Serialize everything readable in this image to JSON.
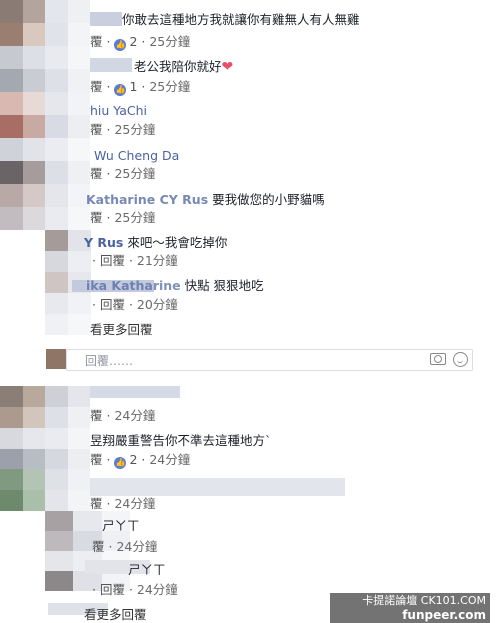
{
  "comments": [
    {
      "text": "你敢去這種地方我就讓你有雞無人有人無雞",
      "reply": "覆",
      "likes": "2",
      "time": "25分鐘"
    },
    {
      "text": "老公我陪你就好",
      "reply": "覆",
      "likes": "1",
      "time": "25分鐘"
    },
    {
      "text": "hiu YaChi",
      "reply": "覆",
      "time": "25分鐘"
    },
    {
      "text": "Wu Cheng Da",
      "reply": "覆",
      "time": "25分鐘"
    },
    {
      "name": "Katharine CY Rus",
      "text": "要我做您的小野貓嗎",
      "reply": "覆",
      "time": "25分鐘"
    }
  ],
  "replies": [
    {
      "name": "Y Rus",
      "text": "來吧～我會吃掉你",
      "reply": "回覆",
      "time": "21分鐘"
    },
    {
      "name": "ika Katharine",
      "text": "快點 狠狠地吃",
      "reply": "回覆",
      "time": "20分鐘"
    }
  ],
  "more_replies_1": "看更多回覆",
  "reply_box_placeholder": "回覆……",
  "comments2": [
    {
      "text": "",
      "reply": "覆",
      "time": "24分鐘"
    },
    {
      "text": "昱翔嚴重警告你不準去這種地方`",
      "reply": "覆",
      "likes": "2",
      "time": "24分鐘"
    },
    {
      "text": "",
      "reply": "覆",
      "time": "24分鐘"
    }
  ],
  "replies2": [
    {
      "text": "ㄕㄚㄒ",
      "reply": "覆",
      "time": "24分鐘"
    },
    {
      "text": "ㄕㄚㄒ",
      "reply": "回覆",
      "time": "24分鐘"
    }
  ],
  "more_replies_2": "看更多回覆",
  "watermark": {
    "line1": "卡提諾論壇 CK101.COM",
    "line2": "funpeer.com"
  },
  "colors": {
    "link": "#4b62a0",
    "like_badge": "#5b7bd5",
    "heart": "#e8506a"
  }
}
